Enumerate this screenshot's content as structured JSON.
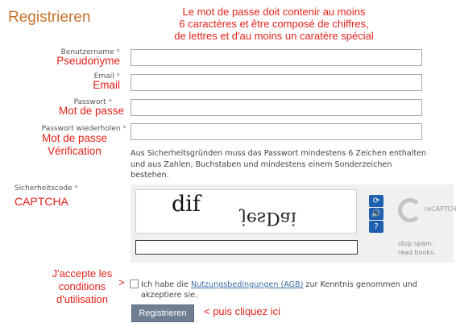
{
  "page": {
    "title": "Registrieren"
  },
  "notes": {
    "top": [
      "Le mot de passe doit contenir au moins",
      "6 caractères et être composé de chiffres,",
      "de lettres et d'au moins un caratère spécial"
    ],
    "pseudonyme": "Pseudonyme",
    "email": "Email",
    "password": "Mot de passe",
    "verify": [
      "Mot de passe",
      "Vérification"
    ],
    "captcha": "CAPTCHA",
    "terms": [
      "J'accepte les",
      "conditions",
      "d'utilisation"
    ],
    "terms_arrow": ">",
    "submit_hint": "< puis cliquez ici"
  },
  "form": {
    "username_label": "Benutzername",
    "email_label": "Email",
    "password_label": "Passwort",
    "password_repeat_label": "Passwort wiederholen",
    "required_mark": "*",
    "password_help": "Aus Sicherheitsgründen muss das Passwort mindestens 6 Zeichen enthalten und aus Zahlen, Buchstaben und mindestens einem Sonderzeichen bestehen.",
    "captcha_label": "Sicherheitscode",
    "captcha_words": [
      "dif",
      "jesDai"
    ],
    "recaptcha_brand": "reCAPTCHA™",
    "recaptcha_tagline": [
      "stop spam.",
      "read books."
    ],
    "terms_before": "Ich habe die ",
    "terms_link": "Nutzungsbedingungen (AGB)",
    "terms_after": " zur Kenntnis genommen und akzeptiere sie.",
    "submit_label": "Registrieren"
  }
}
